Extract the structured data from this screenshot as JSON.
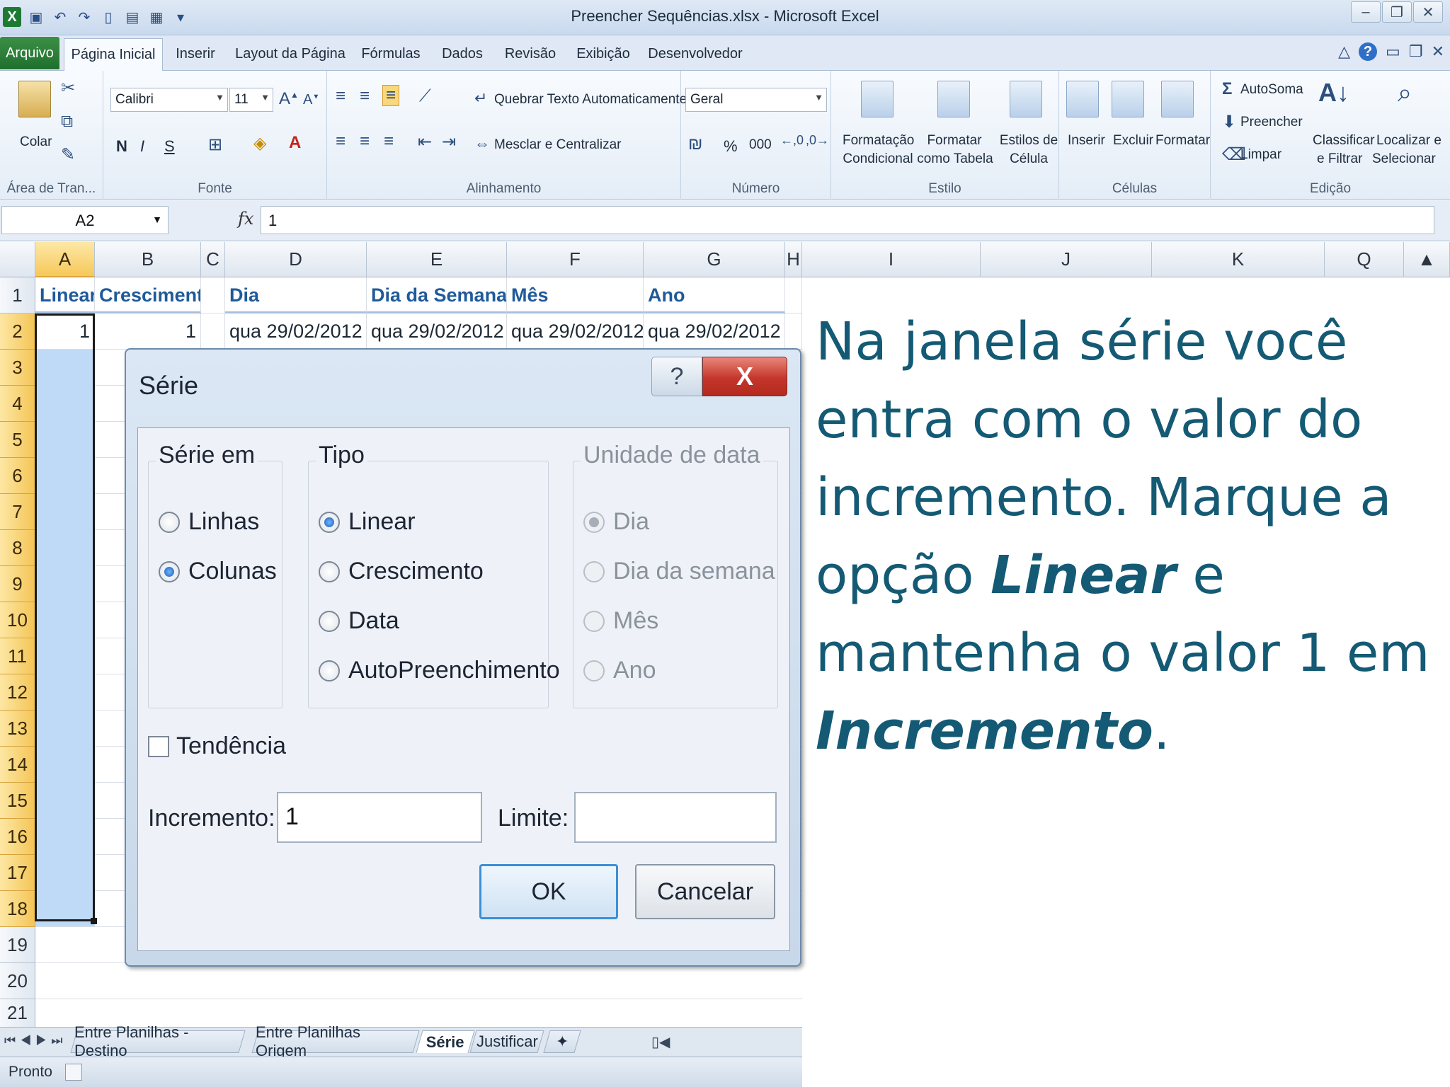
{
  "window": {
    "title": "Preencher Sequências.xlsx - Microsoft Excel"
  },
  "ribbon_tabs": [
    "Arquivo",
    "Página Inicial",
    "Inserir",
    "Layout da Página",
    "Fórmulas",
    "Dados",
    "Revisão",
    "Exibição",
    "Desenvolvedor"
  ],
  "ribbon": {
    "clipboard": {
      "paste": "Colar",
      "label": "Área de Tran..."
    },
    "font": {
      "family": "Calibri",
      "size": "11",
      "bold": "N",
      "italic": "I",
      "underline": "S",
      "label": "Fonte"
    },
    "alignment": {
      "wrap": "Quebrar Texto Automaticamente",
      "merge": "Mesclar e Centralizar",
      "label": "Alinhamento"
    },
    "number": {
      "format": "Geral",
      "percent": "%",
      "thousands": "000",
      "label": "Número"
    },
    "styles": {
      "conditional": [
        "Formatação",
        "Condicional"
      ],
      "table": [
        "Formatar",
        "como Tabela"
      ],
      "cell": [
        "Estilos de",
        "Célula"
      ],
      "label": "Estilo"
    },
    "cells": {
      "insert": "Inserir",
      "delete": "Excluir",
      "format": "Formatar",
      "label": "Células"
    },
    "editing": {
      "autosum": "AutoSoma",
      "fill": "Preencher",
      "clear": "Limpar",
      "sort": [
        "Classificar",
        "e Filtrar"
      ],
      "find": [
        "Localizar e",
        "Selecionar"
      ],
      "label": "Edição"
    }
  },
  "formula_bar": {
    "name_box": "A2",
    "fx": "fx",
    "value": "1"
  },
  "columns": [
    "A",
    "B",
    "C",
    "D",
    "E",
    "F",
    "G",
    "H",
    "I",
    "J",
    "K",
    "Q"
  ],
  "rows": [
    "1",
    "2",
    "3",
    "4",
    "5",
    "6",
    "7",
    "8",
    "9",
    "10",
    "11",
    "12",
    "13",
    "14",
    "15",
    "16",
    "17",
    "18",
    "19",
    "20",
    "21"
  ],
  "headers_row": {
    "A": "Linear",
    "B": "Crescimento",
    "D": "Dia",
    "E": "Dia da Semana",
    "F": "Mês",
    "G": "Ano"
  },
  "data_row": {
    "A": "1",
    "B": "1",
    "D": "qua 29/02/2012",
    "E": "qua 29/02/2012",
    "F": "qua 29/02/2012",
    "G": "qua 29/02/2012"
  },
  "sheet_tabs": [
    "Entre Planilhas - Destino",
    "Entre Planilhas Origem",
    "Série",
    "Justificar"
  ],
  "status": "Pronto",
  "dialog": {
    "title": "Série",
    "help": "?",
    "close": "X",
    "serie_em": {
      "legend": "Série em",
      "options": [
        "Linhas",
        "Colunas"
      ],
      "selected": "Colunas"
    },
    "tipo": {
      "legend": "Tipo",
      "options": [
        "Linear",
        "Crescimento",
        "Data",
        "AutoPreenchimento"
      ],
      "selected": "Linear"
    },
    "unidade": {
      "legend": "Unidade de data",
      "options": [
        "Dia",
        "Dia da semana",
        "Mês",
        "Ano"
      ],
      "selected": "Dia",
      "disabled": true
    },
    "tendencia": "Tendência",
    "incremento_label": "Incremento:",
    "incremento_value": "1",
    "limite_label": "Limite:",
    "limite_value": "",
    "ok": "OK",
    "cancel": "Cancelar"
  },
  "caption": {
    "part1": "Na janela série você entra com o valor do incremento. Marque a opção ",
    "em1": "Linear",
    "part2": " e mantenha o valor 1 em ",
    "em2": "Incremento",
    "part3": "."
  },
  "colors": {
    "caption": "#145a74",
    "selection": "#bfdaf7",
    "header_text": "#1f5a9a"
  }
}
